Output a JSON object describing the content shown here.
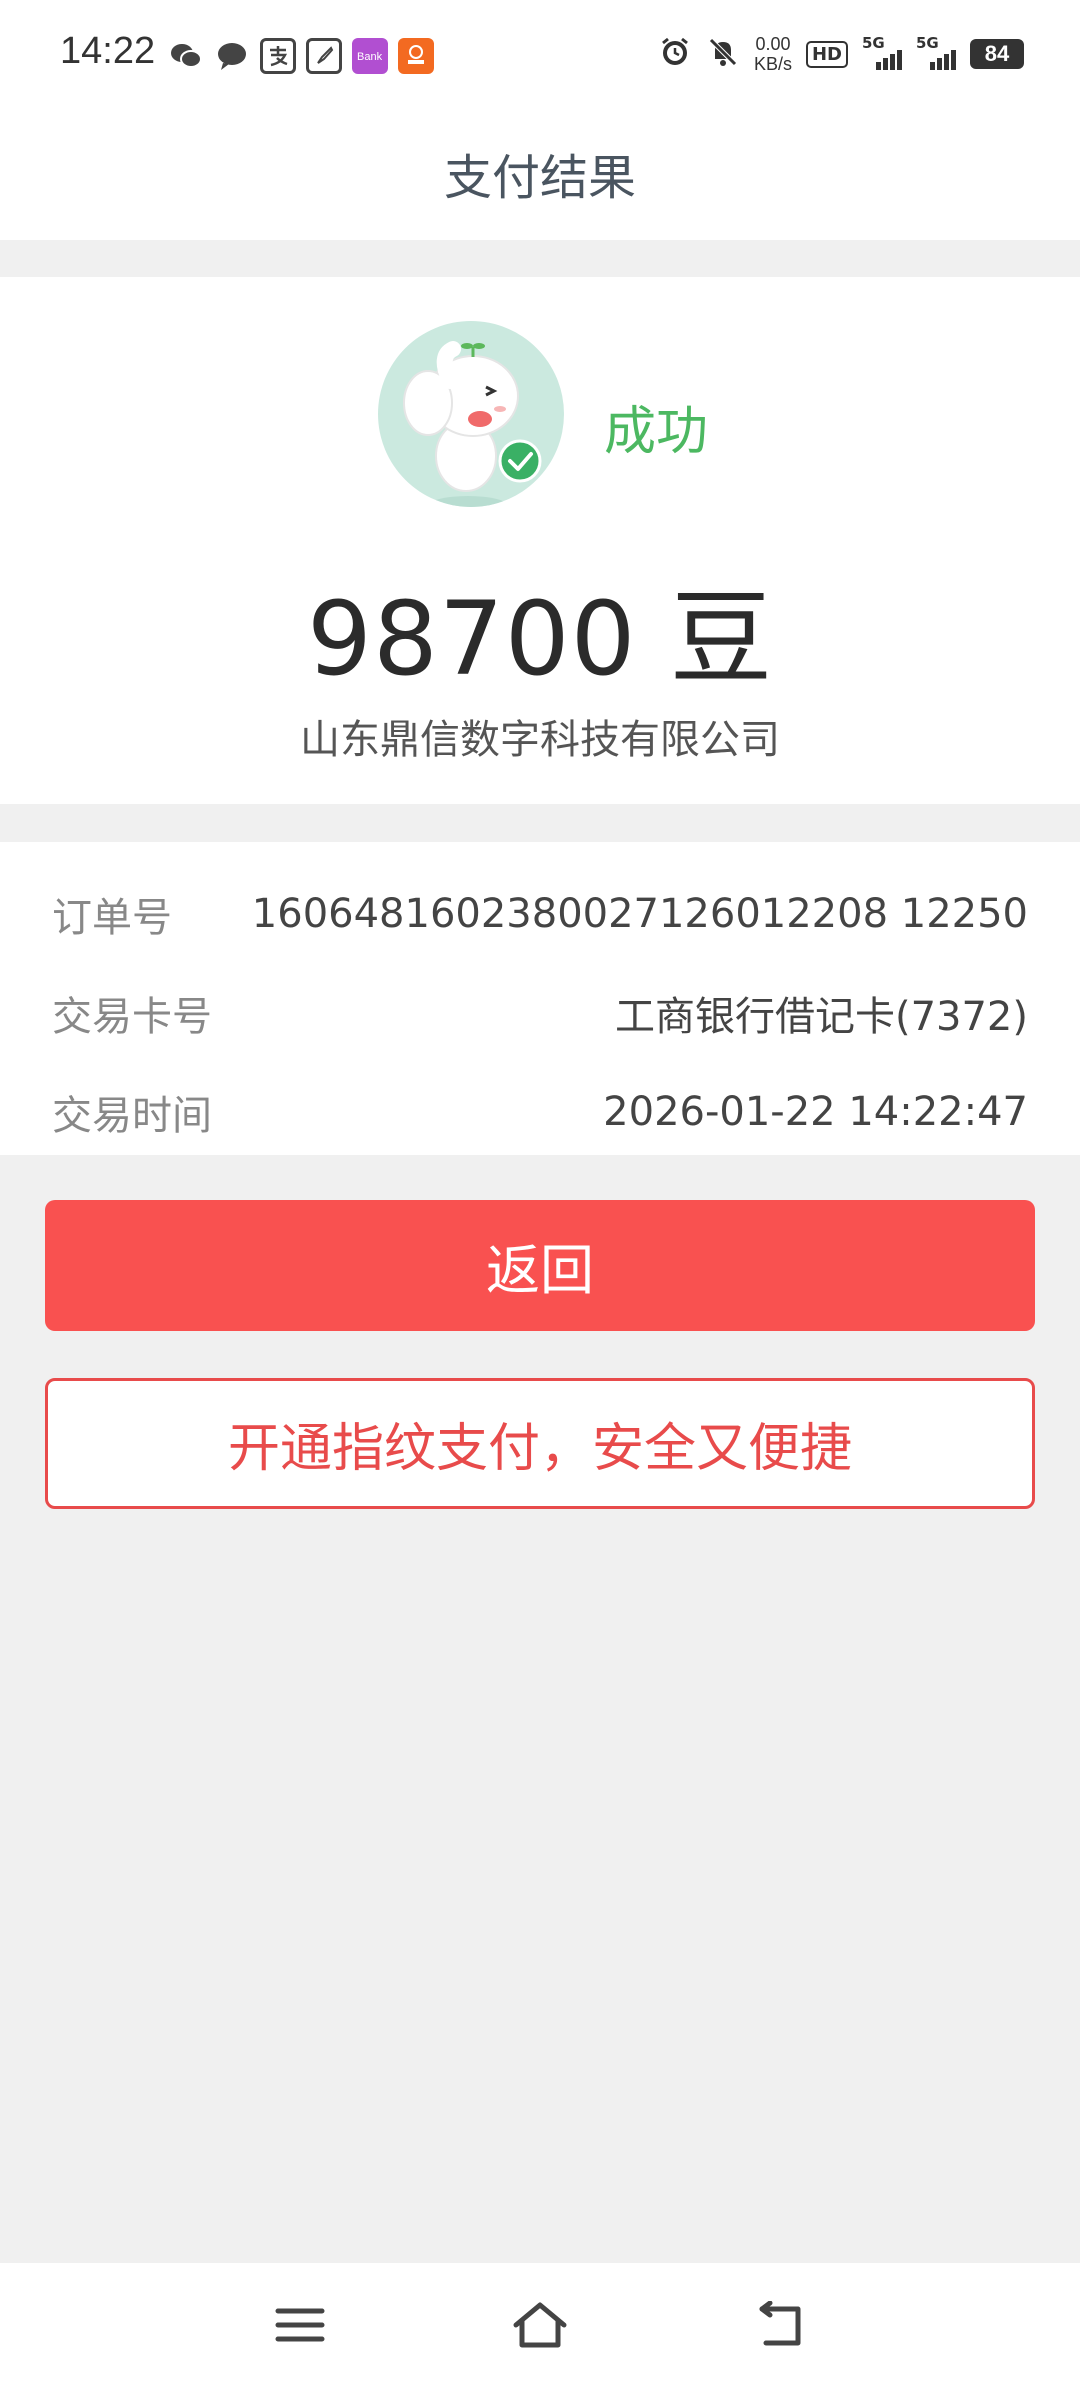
{
  "status_bar": {
    "time": "14:22",
    "net_speed_value": "0.00",
    "net_speed_unit": "KB/s",
    "hd_label": "HD",
    "signal1_label": "5G",
    "signal2_label": "5G",
    "battery": "84",
    "left_icons": [
      "wechat-icon",
      "message-icon",
      "alipay-icon",
      "compass-icon",
      "bank-app-icon",
      "orange-app-icon"
    ],
    "right_icons": [
      "alarm-icon",
      "mute-icon"
    ]
  },
  "header": {
    "title": "支付结果"
  },
  "result": {
    "status": "成功",
    "amount": "98700 豆",
    "merchant": "山东鼎信数字科技有限公司",
    "status_color": "#4cb861"
  },
  "details": {
    "rows": [
      {
        "label": "订单号",
        "value": "1606481602380027126012208 12250"
      },
      {
        "label": "交易卡号",
        "value": "工商银行借记卡(7372)"
      },
      {
        "label": "交易时间",
        "value": "2026-01-22 14:22:47"
      }
    ]
  },
  "actions": {
    "back_label": "返回",
    "fingerprint_label": "开通指纹支付，安全又便捷",
    "primary_color": "#f95150"
  },
  "nav": {
    "icons": [
      "menu-icon",
      "home-icon",
      "back-icon"
    ]
  }
}
